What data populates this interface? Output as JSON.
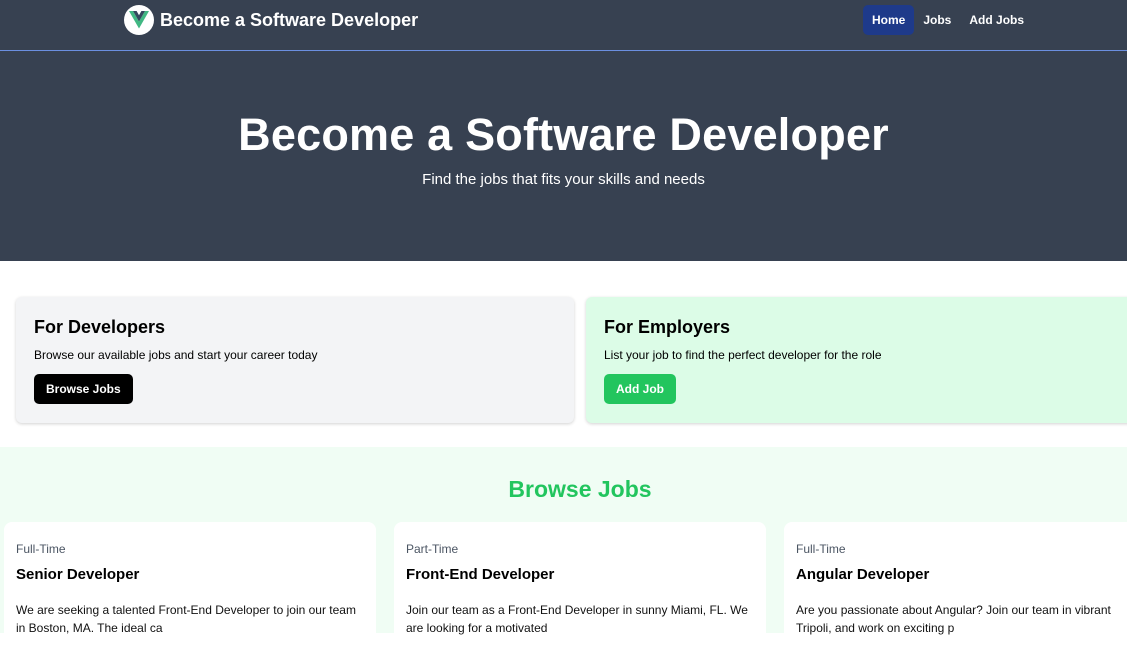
{
  "nav": {
    "brand": "Become a Software Developer",
    "links": [
      {
        "label": "Home",
        "active": true
      },
      {
        "label": "Jobs",
        "active": false
      },
      {
        "label": "Add Jobs",
        "active": false
      }
    ]
  },
  "hero": {
    "title": "Become a Software Developer",
    "subtitle": "Find the jobs that fits your skills and needs"
  },
  "cards": {
    "developers": {
      "title": "For Developers",
      "text": "Browse our available jobs and start your career today",
      "button": "Browse Jobs"
    },
    "employers": {
      "title": "For Employers",
      "text": "List your job to find the perfect developer for the role",
      "button": "Add Job"
    }
  },
  "browse": {
    "title": "Browse Jobs",
    "jobs": [
      {
        "type": "Full-Time",
        "title": "Senior Developer",
        "description": "We are seeking a talented Front-End Developer to join our team in Boston, MA. The ideal ca"
      },
      {
        "type": "Part-Time",
        "title": "Front-End Developer",
        "description": "Join our team as a Front-End Developer in sunny Miami, FL. We are looking for a motivated"
      },
      {
        "type": "Full-Time",
        "title": "Angular Developer",
        "description": "Are you passionate about Angular? Join our team in vibrant Tripoli, and work on exciting p"
      }
    ]
  },
  "colors": {
    "nav_bg": "#374151",
    "active_link": "#1e3a8a",
    "accent_green": "#22c55e",
    "employer_card": "#dcfce7",
    "developer_card": "#f3f4f6"
  },
  "icons": {
    "logo": "vue-logo-icon"
  }
}
